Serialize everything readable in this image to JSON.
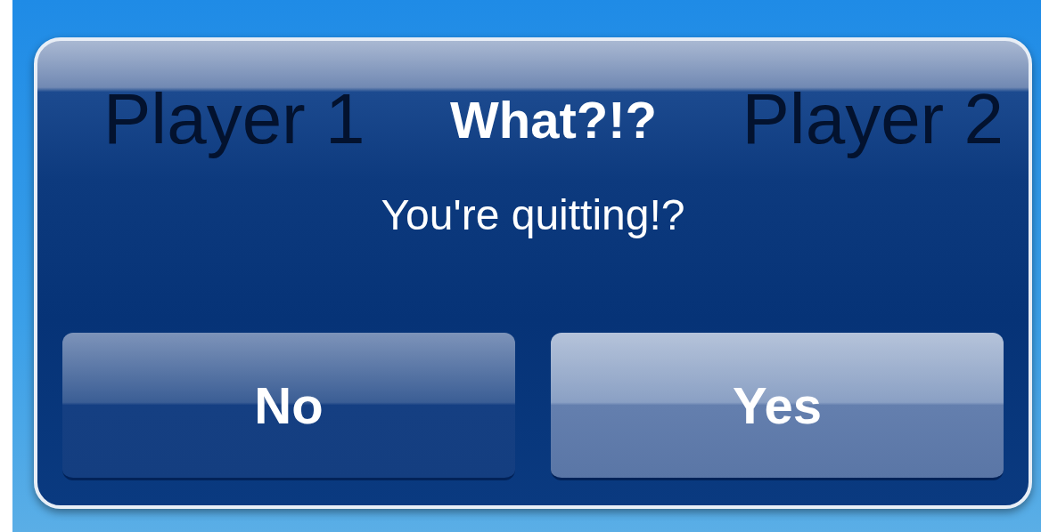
{
  "background_labels": [
    "Player 1",
    "Player 2"
  ],
  "alert": {
    "title": "What?!?",
    "message": "You're quitting!?",
    "buttons": [
      {
        "label": "No",
        "highlighted": false
      },
      {
        "label": "Yes",
        "highlighted": true
      }
    ]
  }
}
